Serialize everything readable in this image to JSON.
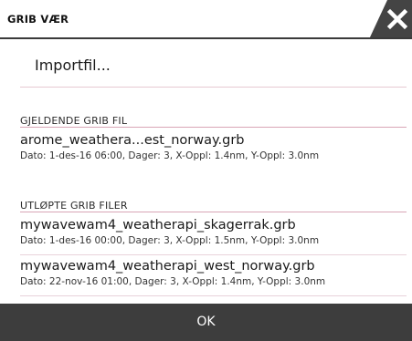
{
  "dialog": {
    "title": "GRIB VÆR",
    "close_icon": "close-icon",
    "import_label": "Importfil...",
    "current_section": {
      "title": "GJELDENDE GRIB FIL",
      "items": [
        {
          "name": "arome_weathera...est_norway.grb",
          "meta": "Dato: 1-des-16 06:00, Dager: 3, X-Oppl: 1.4nm, Y-Oppl: 3.0nm"
        }
      ]
    },
    "expired_section": {
      "title": "UTLØPTE GRIB FILER",
      "items": [
        {
          "name": "mywavewam4_weatherapi_skagerrak.grb",
          "meta": "Dato: 1-des-16 00:00, Dager: 3, X-Oppl: 1.5nm, Y-Oppl: 3.0nm"
        },
        {
          "name": "mywavewam4_weatherapi_west_norway.grb",
          "meta": "Dato: 22-nov-16 01:00, Dager: 3, X-Oppl: 1.4nm, Y-Oppl: 3.0nm"
        }
      ]
    },
    "ok_label": "OK"
  },
  "colors": {
    "header_rule": "#3a3a3a",
    "section_rule": "#d9a6b6",
    "footer_bg": "#3d3d3d",
    "close_bg": "#444444"
  }
}
